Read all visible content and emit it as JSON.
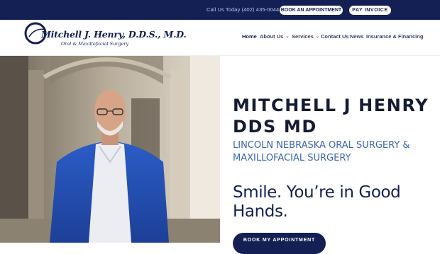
{
  "topbar": {
    "phone": "Call Us Today (402) 435-0044",
    "book_label": "BOOK AN APPOINTMENT",
    "pay_label": "PAY INVOICE"
  },
  "logo": {
    "name": "Mitchell J. Henry, D.D.S., M.D.",
    "subtitle": "Oral & Maxillofacial Surgery"
  },
  "nav": {
    "items": [
      {
        "label": "Home",
        "active": true
      },
      {
        "label": "About Us",
        "dropdown": true
      },
      {
        "label": "Services",
        "dropdown": true
      },
      {
        "label": "Contact Us"
      },
      {
        "label": "News"
      },
      {
        "label": "Insurance & Financing"
      }
    ]
  },
  "hero": {
    "title_line1": "MITCHELL J HENRY",
    "title_line2": "DDS MD",
    "subtitle_line1": "LINCOLN NEBRASKA ORAL SURGERY &",
    "subtitle_line2": "MAXILLOFACIAL SURGERY",
    "tagline_line1": "Smile. You’re in Good",
    "tagline_line2": "Hands.",
    "cta_label": "BOOK MY APPOINTMENT"
  },
  "colors": {
    "navy": "#142054",
    "heading": "#141b33",
    "subtitle_blue": "#3a64b4",
    "white": "#ffffff"
  },
  "icons": {
    "nav_caret": "chevron-down-icon"
  }
}
